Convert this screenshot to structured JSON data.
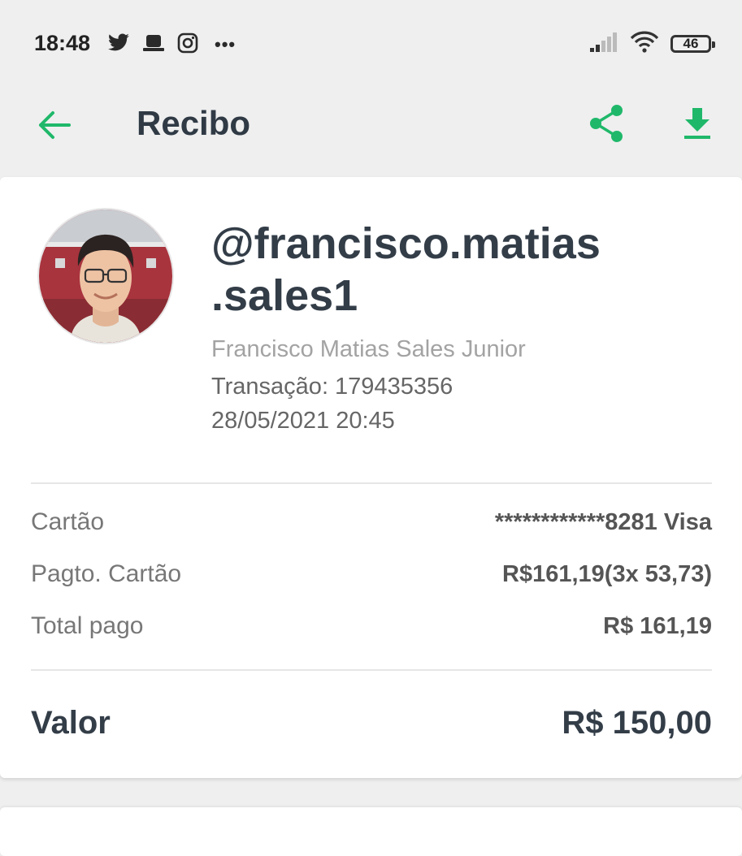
{
  "status_bar": {
    "time": "18:48",
    "battery": "46",
    "more": "•••"
  },
  "app_bar": {
    "title": "Recibo"
  },
  "profile": {
    "username_line1": "@francisco.matias",
    "username_line2": ".sales1",
    "full_name": "Francisco Matias Sales Junior",
    "transaction": "Transação: 179435356",
    "datetime": "28/05/2021 20:45"
  },
  "details": [
    {
      "label": "Cartão",
      "value": "************8281 Visa"
    },
    {
      "label": "Pagto. Cartão",
      "value": "R$161,19(3x 53,73)"
    },
    {
      "label": "Total pago",
      "value": "R$ 161,19"
    }
  ],
  "total": {
    "label": "Valor",
    "value": "R$ 150,00"
  },
  "colors": {
    "accent": "#1fb86a",
    "text_dark": "#2f3a45",
    "background": "#efefef"
  },
  "icons": [
    "twitter-icon",
    "hat-icon",
    "instagram-icon",
    "signal-icon",
    "wifi-icon",
    "battery-icon",
    "back-arrow-icon",
    "share-icon",
    "download-icon"
  ]
}
